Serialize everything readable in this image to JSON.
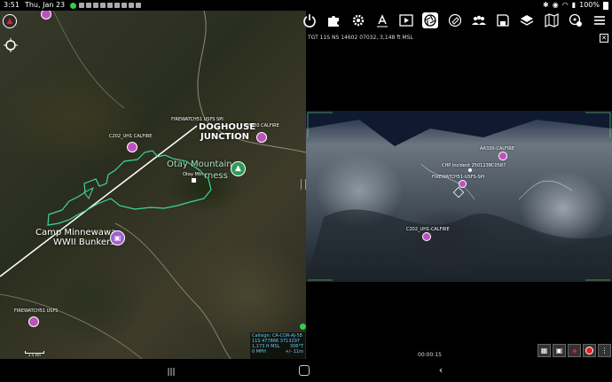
{
  "status_bar": {
    "time": "3:51",
    "date": "Thu, Jan 23",
    "battery": "100%"
  },
  "map": {
    "labels": {
      "firewatch_top": "FIREWATCH51 USFS SPI",
      "aa330": "AA330 CALFIRE",
      "c202": "C202_UH1 CALFIRE",
      "doghouse_1": "DOGHOUSE",
      "doghouse_2": "JUNCTION",
      "otay": "Otay Mountain",
      "otay_2": "rness",
      "otay_mtn_small": "Otay Mtn",
      "camp_1": "Camp Minnewawa",
      "camp_2": "WWII Bunkers",
      "firewatch_bottom": "FIREWATCH51 USFS"
    },
    "scale_label": "2.5 km",
    "callsign_box": {
      "line1": "Callsign: CA-COR-AJ-58",
      "line2": "11S 477866 3713297",
      "line3": "1,173 ft MSL",
      "line3b": "306°T",
      "line4": "0 MPH",
      "line4b": "+/- 11m"
    }
  },
  "video": {
    "tgt_readout": "TGT 11S NS 14602 07032",
    "altitude": "3,148 ft MSL",
    "labels": {
      "aa330": "AA330-CALFIRE",
      "chp": "CHP Incident 250123BC0587",
      "firewatch": "FIREWATCH51-USFS-SPI",
      "c202": "C202_UH1-CALFIRE"
    },
    "timer": "00:00:15"
  },
  "toolbar": {
    "icons": [
      "power",
      "puzzle",
      "gear",
      "text-tool",
      "video-player",
      "shutter",
      "tag",
      "group",
      "save",
      "layers",
      "map",
      "location-settings",
      "menu"
    ]
  },
  "colors": {
    "accent_record": "#e02020",
    "unit_marker": "#c050c0",
    "poi_green": "#2e9a5a",
    "fire_outline": "#3fd6a0"
  }
}
